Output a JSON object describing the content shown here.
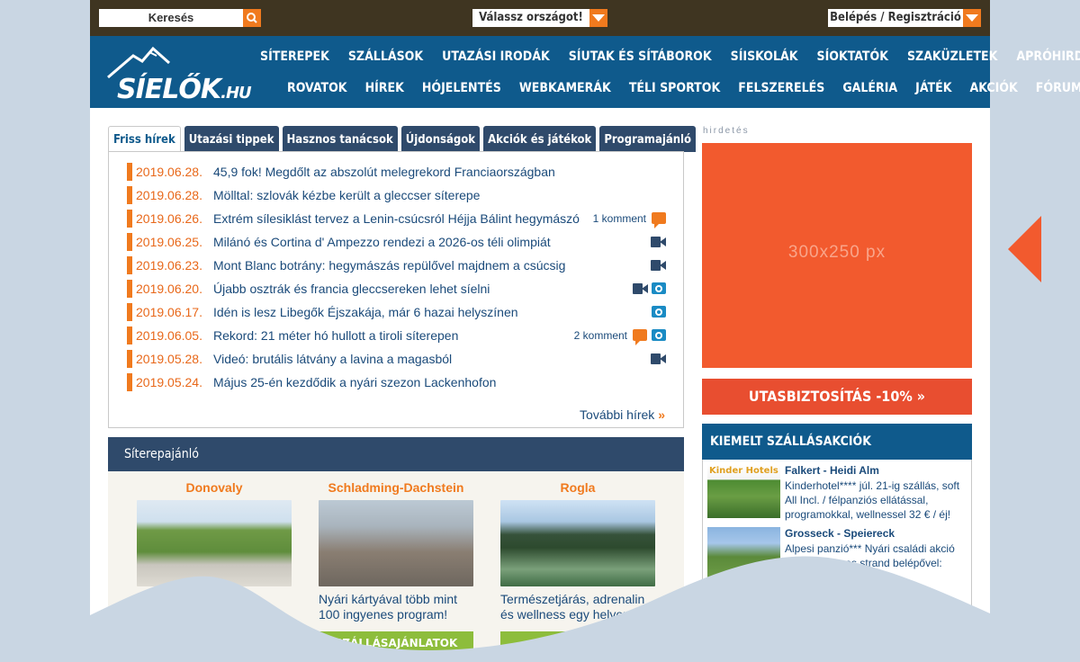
{
  "topbar": {
    "search_label": "Keresés",
    "country_label": "Válassz országot!",
    "login_label": "Belépés / Regisztráció"
  },
  "logo": {
    "main": "SÍELŐK",
    "suffix": ".HU"
  },
  "nav": {
    "row1": [
      "SÍTEREPEK",
      "SZÁLLÁSOK",
      "UTAZÁSI IRODÁK",
      "SÍUTAK ÉS SÍTÁBOROK",
      "SÍISKOLÁK",
      "SÍOKTATÓK",
      "SZAKÜZLETEK",
      "APRÓHIRDETÉSEK"
    ],
    "row2": [
      "ROVATOK",
      "HÍREK",
      "HÓJELENTÉS",
      "WEBKAMERÁK",
      "TÉLI SPORTOK",
      "FELSZERELÉS",
      "GALÉRIA",
      "JÁTÉK",
      "AKCIÓK",
      "FÓRUM"
    ]
  },
  "tabs": [
    "Friss hírek",
    "Utazási tippek",
    "Hasznos tanácsok",
    "Újdonságok",
    "Akciók és játékok",
    "Programajánló"
  ],
  "news": [
    {
      "date": "2019.06.28.",
      "title": "45,9 fok! Megdőlt az abszolút melegrekord Franciaországban",
      "comments": "",
      "icons": []
    },
    {
      "date": "2019.06.28.",
      "title": "Mölltal: szlovák kézbe került a gleccser síterepe",
      "comments": "",
      "icons": []
    },
    {
      "date": "2019.06.26.",
      "title": "Extrém sílesiklást tervez a Lenin-csúcsról Héjja Bálint hegymászó",
      "comments": "1 komment",
      "icons": [
        "comment-icon"
      ]
    },
    {
      "date": "2019.06.25.",
      "title": "Milánó és Cortina d' Ampezzo rendezi a 2026-os téli olimpiát",
      "comments": "",
      "icons": [
        "video-icon"
      ]
    },
    {
      "date": "2019.06.23.",
      "title": "Mont Blanc botrány: hegymászás repülővel majdnem a csúcsig",
      "comments": "",
      "icons": [
        "video-icon"
      ]
    },
    {
      "date": "2019.06.20.",
      "title": "Újabb osztrák és francia gleccsereken lehet síelni",
      "comments": "",
      "icons": [
        "video-icon",
        "camera-icon"
      ]
    },
    {
      "date": "2019.06.17.",
      "title": "Idén is lesz Libegők Éjszakája, már 6 hazai helyszínen",
      "comments": "",
      "icons": [
        "camera-icon"
      ]
    },
    {
      "date": "2019.06.05.",
      "title": "Rekord: 21 méter hó hullott a tiroli síterepen",
      "comments": "2 komment",
      "icons": [
        "comment-icon",
        "camera-icon"
      ]
    },
    {
      "date": "2019.05.28.",
      "title": "Videó: brutális látvány a lavina a magasból",
      "comments": "",
      "icons": [
        "video-icon"
      ]
    },
    {
      "date": "2019.05.24.",
      "title": "Május 25-én kezdődik a nyári szezon Lackenhofon",
      "comments": "",
      "icons": []
    }
  ],
  "more_news": "További hírek",
  "resorts": {
    "heading": "Síterepajánló",
    "items": [
      {
        "name": "Donovaly",
        "desc": "",
        "button": ""
      },
      {
        "name": "Schladming-Dachstein",
        "desc": "Nyári kártyával több mint 100 ingyenes program!",
        "button": "SZÁLLÁSAJÁNLATOK"
      },
      {
        "name": "Rogla",
        "desc": "Természetjárás, adrenalin és wellness egy helyen",
        "button": ""
      }
    ]
  },
  "ad": {
    "label": "hirdetés",
    "size": "300x250 px"
  },
  "insurance": "UTASBIZTOSÍTÁS -10% »",
  "hot_deals": {
    "heading": "KIEMELT SZÁLLÁSAKCIÓK",
    "items": [
      {
        "name": "Falkert - Heidi Alm",
        "desc": "Kinderhotel**** júl. 21-ig szállás, soft All Incl. / félpanziós ellátással, programokkal, wellnessel 32 € / éj!",
        "thumb_text": "Kinder Hotels"
      },
      {
        "name": "Grosseck - Speiereck",
        "desc": "Alpesi panzió*** Nyári családi akció kedvezményes strand belépővel:",
        "thumb_text": ""
      }
    ]
  },
  "colors": {
    "accent": "#f07a1e",
    "nav_blue": "#0f5a8c",
    "topbar": "#3f3521",
    "ad": "#f25a2e"
  }
}
